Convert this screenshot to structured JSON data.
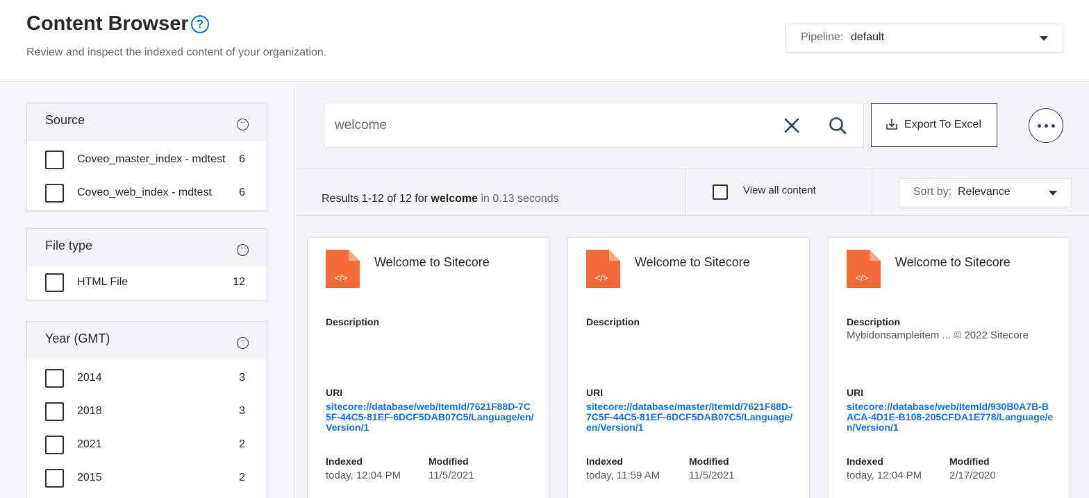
{
  "header": {
    "title": "Content Browser",
    "help_icon": "?",
    "subtitle": "Review and inspect the indexed content of your organization.",
    "pipeline_label": "Pipeline:",
    "pipeline_value": "default"
  },
  "facets": [
    {
      "title": "Source",
      "items": [
        {
          "label": "Coveo_master_index - mdtest",
          "count": "6"
        },
        {
          "label": "Coveo_web_index - mdtest",
          "count": "6"
        }
      ]
    },
    {
      "title": "File type",
      "items": [
        {
          "label": "HTML File",
          "count": "12"
        }
      ]
    },
    {
      "title": "Year (GMT)",
      "items": [
        {
          "label": "2014",
          "count": "3"
        },
        {
          "label": "2018",
          "count": "3"
        },
        {
          "label": "2021",
          "count": "2"
        },
        {
          "label": "2015",
          "count": "2"
        }
      ]
    }
  ],
  "search": {
    "value": "welcome",
    "export_label": "Export To Excel"
  },
  "results": {
    "prefix": "Results 1-12 of 12 for",
    "query": "welcome",
    "timing": "in 0.13 seconds",
    "view_all_label": "View all content",
    "sort_label": "Sort by:",
    "sort_value": "Relevance"
  },
  "labels": {
    "description": "Description",
    "uri": "URI",
    "indexed": "Indexed",
    "modified": "Modified",
    "file_icon_text": "</>"
  },
  "cards": [
    {
      "title": "Welcome to Sitecore",
      "description": "",
      "uri": "sitecore://database/web/ItemId/7621F88D-7C5F-44C5-81EF-6DCF5DAB07C5/Language/en/Version/1",
      "indexed": "today, 12:04 PM",
      "modified": "11/5/2021"
    },
    {
      "title": "Welcome to Sitecore",
      "description": "",
      "uri": "sitecore://database/master/ItemId/7621F88D-7C5F-44C5-81EF-6DCF5DAB07C5/Language/en/Version/1",
      "indexed": "today, 11:59 AM",
      "modified": "11/5/2021"
    },
    {
      "title": "Welcome to Sitecore",
      "description": "Mybidonsampleitem ... © 2022 Sitecore",
      "uri": "sitecore://database/web/ItemId/930B0A7B-BACA-4D1E-B108-205CFDA1E778/Language/en/Version/1",
      "indexed": "today, 12:04 PM",
      "modified": "2/17/2020"
    }
  ],
  "colors": {
    "accent": "#1372ec",
    "file_icon": "#f26b38",
    "file_icon_fold": "#f9a886"
  }
}
